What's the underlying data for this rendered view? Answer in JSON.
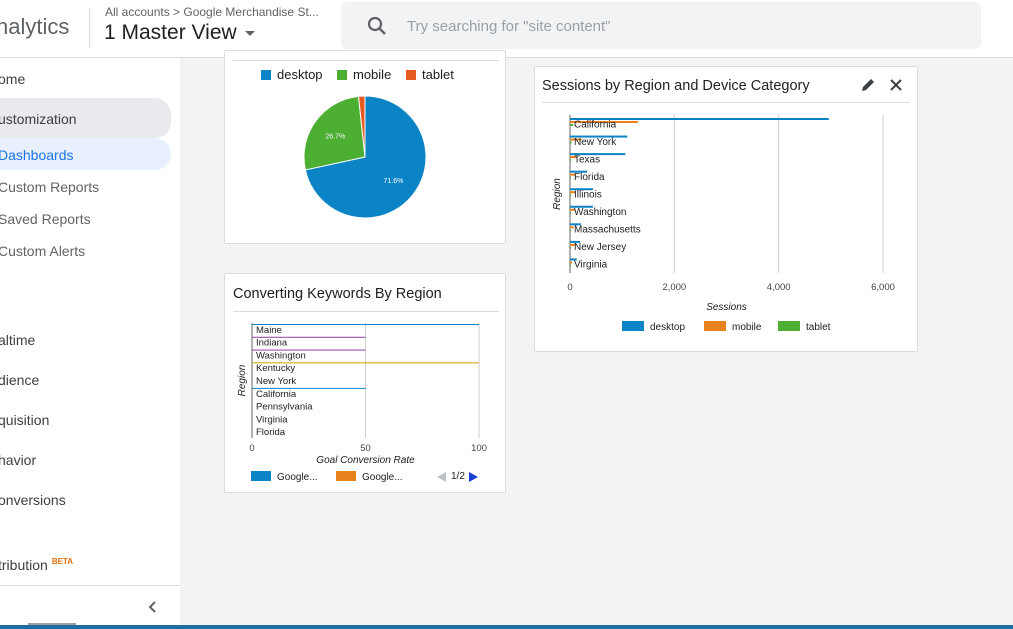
{
  "header": {
    "brand": "nalytics",
    "account_path": "All accounts > Google Merchandise St...",
    "view_name": "1 Master View",
    "search_placeholder": "Try searching for \"site content\""
  },
  "sidebar": {
    "items": [
      {
        "label": "ome"
      },
      {
        "label": "ustomization"
      },
      {
        "label": "Dashboards"
      },
      {
        "label": "Custom Reports"
      },
      {
        "label": "Saved Reports"
      },
      {
        "label": "Custom Alerts"
      },
      {
        "label": "altime"
      },
      {
        "label": "dience"
      },
      {
        "label": "quisition"
      },
      {
        "label": "havior"
      },
      {
        "label": "onversions"
      },
      {
        "label": "tribution"
      }
    ],
    "beta_label": "BETA"
  },
  "colors": {
    "desktop": "#0b84c6",
    "mobile": "#4cae33",
    "tablet": "#e85a24",
    "orange": "#e8821e",
    "purple": "#8e3fa8",
    "gold": "#c8a000"
  },
  "pie_card": {
    "legend": [
      "desktop",
      "mobile",
      "tablet"
    ],
    "chart_data": {
      "type": "pie",
      "slices": [
        {
          "label": "desktop",
          "value": 71.6,
          "text": "71.6%"
        },
        {
          "label": "mobile",
          "value": 26.7,
          "text": "26.7%"
        },
        {
          "label": "tablet",
          "value": 1.7
        }
      ]
    }
  },
  "keywords_card": {
    "title": "Converting Keywords By Region",
    "legend": [
      "Google...",
      "Google..."
    ],
    "pager": "1/2",
    "chart_data": {
      "type": "bar",
      "orientation": "horizontal",
      "categories": [
        "Maine",
        "Indiana",
        "Washington",
        "Kentucky",
        "New York",
        "California",
        "Pennsylvania",
        "Virginia",
        "Florida"
      ],
      "series": [
        {
          "name": "Google...",
          "values": [
            100,
            0,
            0,
            0,
            0,
            50,
            0,
            0,
            0
          ]
        },
        {
          "name": "Google...",
          "values": [
            0,
            0,
            0,
            100,
            0,
            0,
            0,
            0,
            0
          ]
        },
        {
          "values": [
            0,
            50,
            50,
            0,
            0,
            0,
            0,
            0,
            0
          ]
        }
      ],
      "xlabel": "Goal Conversion Rate",
      "ylabel": "Region",
      "xlim": [
        0,
        100
      ],
      "xticks": [
        "0",
        "50",
        "100"
      ]
    }
  },
  "sessions_card": {
    "title": "Sessions by Region and Device Category",
    "chart_data": {
      "type": "bar",
      "orientation": "horizontal",
      "categories": [
        "California",
        "New York",
        "Texas",
        "Florida",
        "Illinois",
        "Washington",
        "Massachusetts",
        "New Jersey",
        "Virginia"
      ],
      "series": [
        {
          "name": "desktop",
          "values": [
            4960,
            1100,
            1060,
            330,
            440,
            440,
            210,
            190,
            130
          ]
        },
        {
          "name": "mobile",
          "values": [
            1300,
            220,
            130,
            110,
            110,
            90,
            70,
            110,
            40
          ]
        },
        {
          "name": "tablet",
          "values": [
            60,
            30,
            20,
            20,
            10,
            10,
            10,
            10,
            10
          ]
        }
      ],
      "xlabel": "Sessions",
      "ylabel": "Region",
      "xlim": [
        0,
        6000
      ],
      "xticks": [
        "0",
        "2,000",
        "4,000",
        "6,000"
      ],
      "legend": [
        "desktop",
        "mobile",
        "tablet"
      ]
    }
  }
}
